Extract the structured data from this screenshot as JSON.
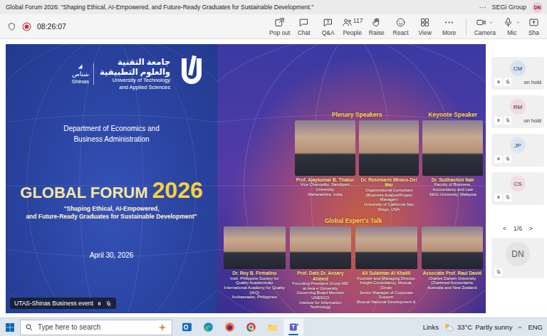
{
  "window": {
    "title": "Global Forum 2026: \"Shaping Ethical, AI-Empowered, and Future-Ready Graduates for Sustainable Development.\"",
    "more": "···",
    "org": "SEGi Group",
    "user": "DN"
  },
  "meeting": {
    "timer": "08:26:07",
    "recording": true
  },
  "toolbar": [
    {
      "label": "Pop out",
      "kind": "popout"
    },
    {
      "label": "Chat",
      "kind": "chat"
    },
    {
      "label": "Q&A",
      "kind": "qa"
    },
    {
      "label": "People",
      "kind": "people",
      "count": "117"
    },
    {
      "label": "Raise",
      "kind": "raise"
    },
    {
      "label": "React",
      "kind": "react"
    },
    {
      "label": "View",
      "kind": "view"
    },
    {
      "label": "More",
      "kind": "more"
    }
  ],
  "devices": [
    {
      "label": "Camera",
      "kind": "camera"
    },
    {
      "label": "Mic",
      "kind": "mic"
    },
    {
      "label": "Sha",
      "kind": "share"
    }
  ],
  "slide": {
    "campus_ar": "شناص",
    "campus_en": "Shinas",
    "university_ar": [
      "جامعة التقنية",
      "والعلوم التطبيقية"
    ],
    "university_en": [
      "University of Technology",
      "and Applied Sciences"
    ],
    "department": [
      "Department of Economics and",
      "Business Administration"
    ],
    "title": "GLOBAL FORUM",
    "year": "2026",
    "subtitle": [
      "\"Shaping Ethical, AI-Empowered,",
      "and Future-Ready Graduates for Sustainable Development\""
    ],
    "date": "April 30, 2026",
    "top_groups": [
      {
        "title": "Plenary Speakers",
        "speakers": [
          {
            "name": "Prof. Ajaykumar B. Thakur",
            "lines": [
              "Vice Chancellor, Sandipani University",
              "Maharashtra, India"
            ]
          },
          {
            "name": "Dr. Rosemarie Mirano-Del Mar",
            "lines": [
              "Organizational Consultant",
              "(Business Analyst/Project Manager)",
              "University of California San Diego, USA"
            ]
          }
        ]
      },
      {
        "title": "Keynote Speaker",
        "speakers": [
          {
            "name": "Dr. Sudhashini Nair",
            "lines": [
              "Faculty of Business, Accountancy and Law",
              "SEGi University, Malaysia"
            ]
          }
        ]
      }
    ],
    "experts": {
      "title": "Global Expert's Talk",
      "speakers": [
        {
          "name": "Dr. Roy B. Firmalino",
          "lines": [
            "Instr. Philippine Society for Quality Academician",
            "International Academy for Quality (IAQ)",
            "Ambassador, Philippines"
          ]
        },
        {
          "name": "Prof. Dato Dr. Ansary Ahmed",
          "lines": [
            "Founding President Group MD",
            "at Asia e University",
            "Governing Board Member UNESCO",
            "Institute for Information Technology"
          ]
        },
        {
          "name": "Ali Sulaiman Al Khalili",
          "lines": [
            "Founder and Managing Director",
            "Insight Consultancy, Muscat, Oman",
            "Senior Manager of Corporate Support",
            "Muscat National Development &"
          ]
        },
        {
          "name": "Associate Prof. Raul David",
          "lines": [
            "Charles Darwin University",
            "Chartered Accountants",
            "Australia and New Zealand"
          ]
        }
      ]
    }
  },
  "presenter_label": "UTAS-Shinas Business event",
  "participants": [
    {
      "initials": "CM",
      "status": "on hold",
      "color": "#d6e2ef"
    },
    {
      "initials": "RM",
      "status": "on hold",
      "color": "#f3d9e0"
    },
    {
      "initials": "JP",
      "color": "#d9e6f3"
    },
    {
      "initials": "CS",
      "color": "#f5dce2"
    }
  ],
  "pager": {
    "prev": "<",
    "text": "1/6",
    "next": ">"
  },
  "self": {
    "initials": "DN",
    "color": "#e4e4e4"
  },
  "taskbar": {
    "search": "Type here to search",
    "apps": [
      {
        "kind": "outlook",
        "selected": false
      },
      {
        "kind": "edge",
        "selected": false
      },
      {
        "kind": "firefox",
        "selected": false
      },
      {
        "kind": "chrome",
        "selected": false
      },
      {
        "kind": "explorer",
        "selected": false
      },
      {
        "kind": "teams",
        "selected": true
      }
    ],
    "links": "Links",
    "weather": {
      "temp": "33°C",
      "text": "Partly sunny"
    },
    "lang": "ENG"
  }
}
